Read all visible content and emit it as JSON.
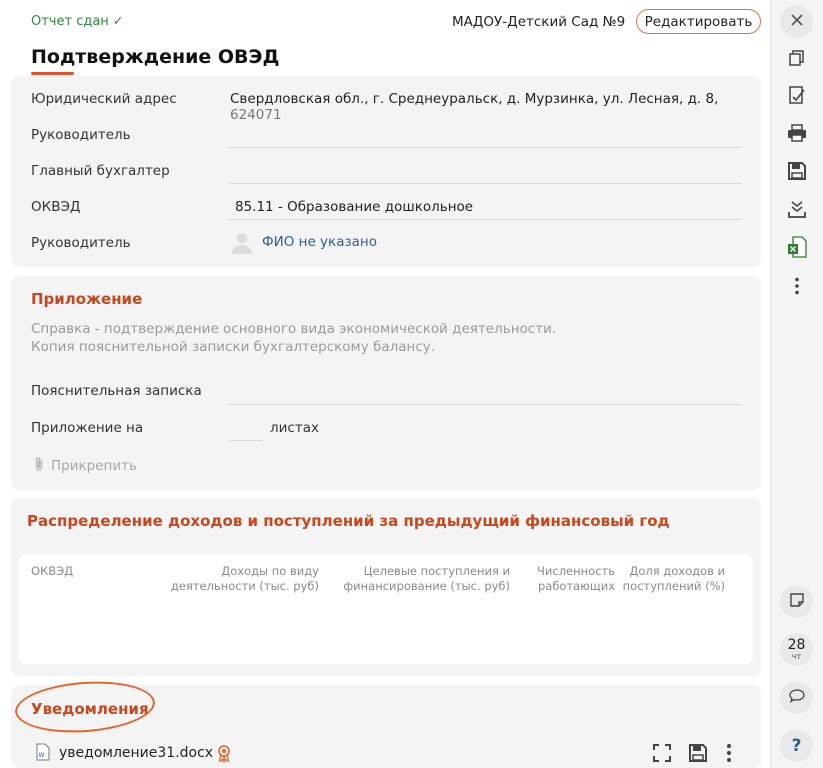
{
  "header": {
    "status": "Отчет сдан",
    "status_check": "✓",
    "organization": "МАДОУ-Детский Сад №9",
    "edit_label": "Редактировать",
    "title": "Подтверждение ОВЭД"
  },
  "info": {
    "address_label": "Юридический адрес",
    "address_value": "Свердловская обл., г. Среднеуральск, д. Мурзинка, ул. Лесная, д. 8,",
    "address_zip": "624071",
    "head_label": "Руководитель",
    "head_value": "",
    "accountant_label": "Главный бухгалтер",
    "accountant_value": "",
    "okved_label": "ОКВЭД",
    "okved_value": "85.11 - Образование дошкольное",
    "manager_label": "Руководитель",
    "manager_value": "ФИО не указано"
  },
  "attachment": {
    "title": "Приложение",
    "hint_line1": "Справка - подтверждение основного вида экономической деятельности.",
    "hint_line2": "Копия пояснительной записки бухгалтерскому балансу.",
    "note_label": "Пояснительная записка",
    "note_value": "",
    "pages_label": "Приложение на",
    "pages_value": "",
    "pages_suffix": "листах",
    "attach_label": "Прикрепить"
  },
  "distribution": {
    "title": "Распределение доходов и поступлений за предыдущий финансовый год",
    "columns": [
      {
        "line1": "ОКВЭД",
        "line2": ""
      },
      {
        "line1": "Доходы по виду",
        "line2": "деятельности (тыс. руб)"
      },
      {
        "line1": "Целевые поступления и",
        "line2": "финансирование (тыс. руб)"
      },
      {
        "line1": "Численность",
        "line2": "работающих"
      },
      {
        "line1": "Доля доходов и",
        "line2": "поступлений (%)"
      }
    ]
  },
  "notifications": {
    "title": "Уведомления",
    "file_name": "уведомление31.docx"
  },
  "rail": {
    "date_number": "28",
    "date_weekday": "чт",
    "help": "?"
  },
  "colors": {
    "accent": "#c8471c",
    "success": "#2f8a3c",
    "link": "#2a5f9e"
  }
}
